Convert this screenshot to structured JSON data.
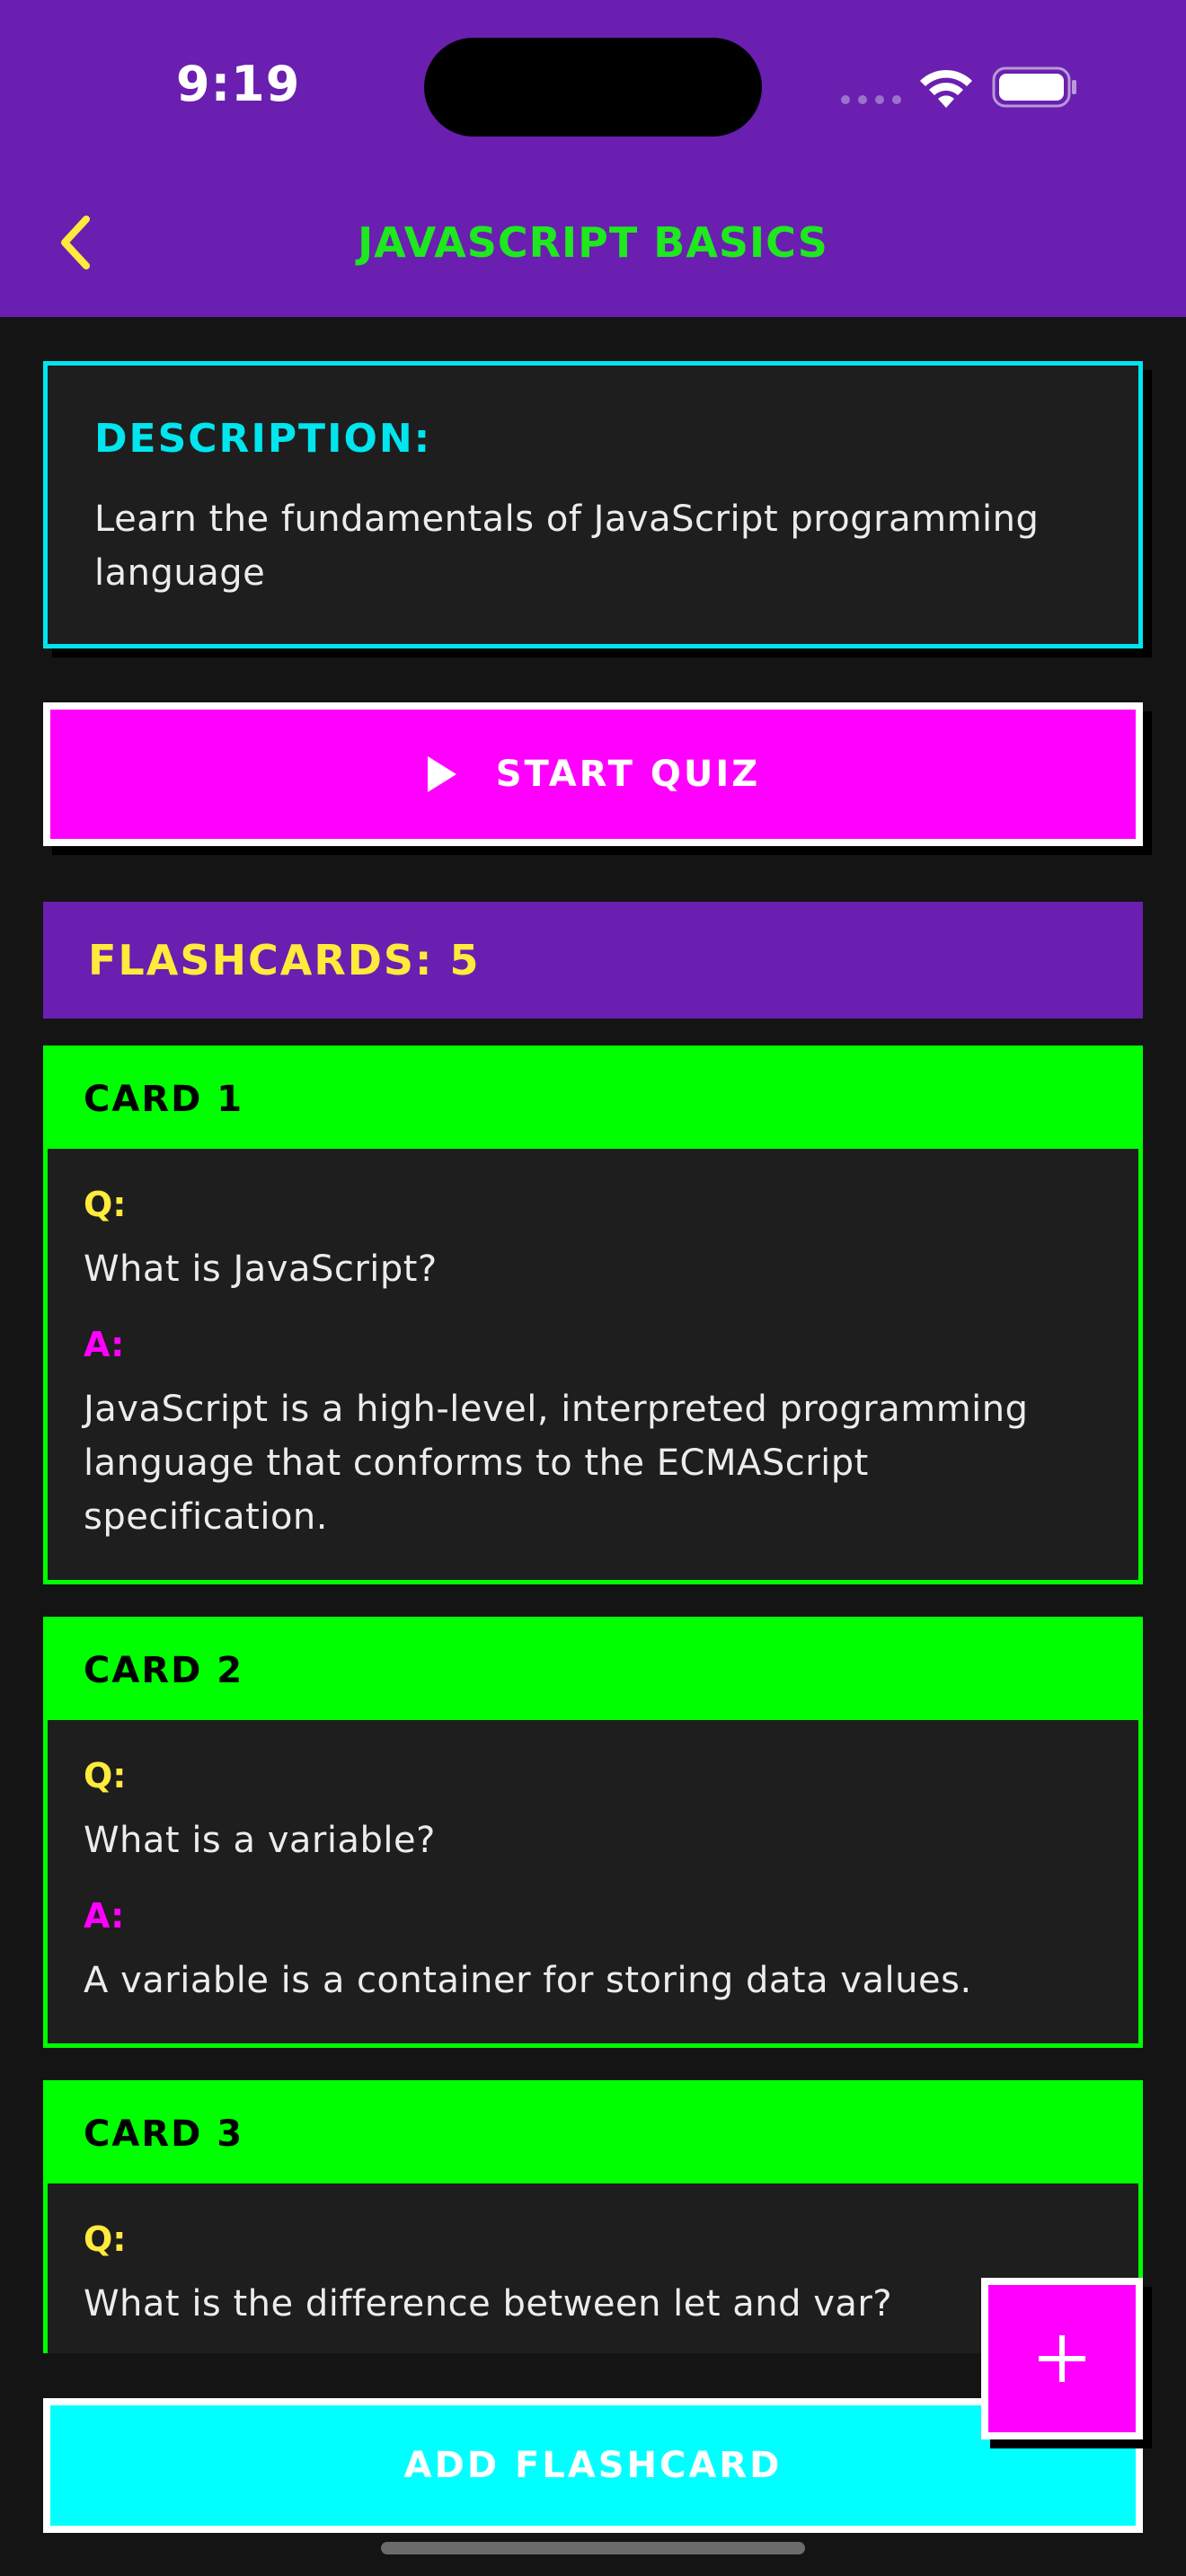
{
  "status_bar": {
    "time": "9:19"
  },
  "header": {
    "title": "JAVASCRIPT BASICS",
    "back_icon": "chevron-left-icon"
  },
  "description": {
    "label": "DESCRIPTION:",
    "text": "Learn the fundamentals of JavaScript programming language"
  },
  "start_quiz": {
    "label": "START QUIZ",
    "icon": "play-icon"
  },
  "flashcards": {
    "header": "FLASHCARDS: 5",
    "cards": [
      {
        "title": "CARD 1",
        "q_label": "Q:",
        "question": "What is JavaScript?",
        "a_label": "A:",
        "answer": "JavaScript is a high-level, interpreted programming language that conforms to the ECMAScript specification."
      },
      {
        "title": "CARD 2",
        "q_label": "Q:",
        "question": "What is a variable?",
        "a_label": "A:",
        "answer": "A variable is a container for storing data values."
      },
      {
        "title": "CARD 3",
        "q_label": "Q:",
        "question": "What is the difference between let and var?"
      }
    ]
  },
  "fab": {
    "icon": "plus-icon"
  },
  "add_flashcard": {
    "label": "ADD FLASHCARD"
  },
  "colors": {
    "header_bg": "#6a1fb0",
    "title": "#1ee81e",
    "accent_cyan": "#00e5ee",
    "accent_magenta": "#ff00ff",
    "accent_green": "#00ff00",
    "accent_yellow": "#ffeb3b",
    "background": "#141414"
  }
}
